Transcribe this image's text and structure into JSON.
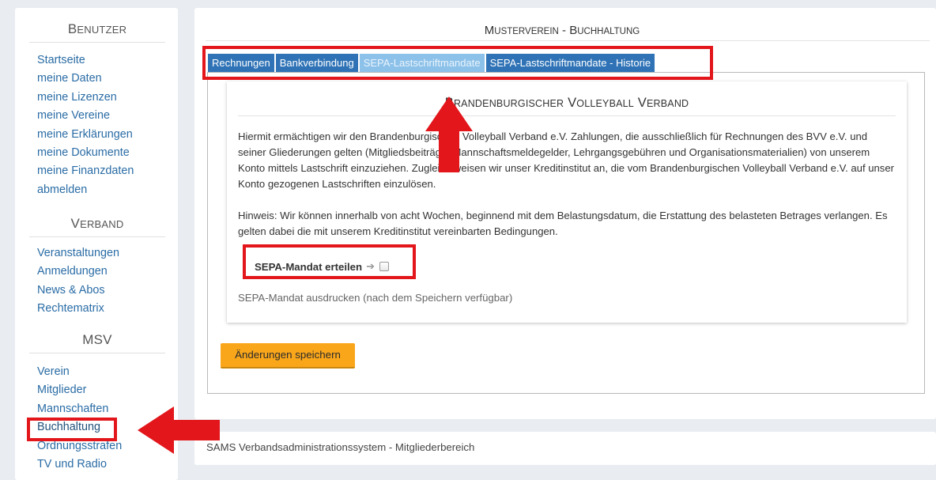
{
  "sidebar": {
    "sections": [
      {
        "title_cap": "B",
        "title_rest": "ENUTZER",
        "items": [
          "Startseite",
          "meine Daten",
          "meine Lizenzen",
          "meine Vereine",
          "meine Erklärungen",
          "meine Dokumente",
          "meine Finanzdaten",
          "abmelden"
        ]
      },
      {
        "title_cap": "V",
        "title_rest": "ERBAND",
        "items": [
          "Veranstaltungen",
          "Anmeldungen",
          "News & Abos",
          "Rechtematrix"
        ]
      },
      {
        "title_cap": "MSV",
        "title_rest": "",
        "items": [
          "Verein",
          "Mitglieder",
          "Mannschaften",
          "Buchhaltung",
          "Ordnungsstrafen",
          "TV und Radio"
        ]
      }
    ]
  },
  "main": {
    "title": {
      "cap1": "M",
      "rest1": "USTERVEREIN",
      "sep": " - ",
      "cap2": "B",
      "rest2": "UCHHALTUNG"
    },
    "tabs": [
      "Rechnungen",
      "Bankverbindung",
      "SEPA-Lastschriftmandate",
      "SEPA-Lastschriftmandate - Historie"
    ],
    "active_tab": "SEPA-Lastschriftmandate",
    "card": {
      "title": {
        "cap1": "B",
        "rest1": "RANDENBURGISCHER",
        "cap2": "V",
        "rest2": "OLLEYBALL",
        "cap3": "V",
        "rest3": "ERBAND"
      },
      "paragraph1": "Hiermit ermächtigen wir den Brandenburgischen Volleyball Verband e.V. Zahlungen, die ausschließlich für Rechnungen des BVV e.V. und seiner Gliederungen gelten (Mitgliedsbeiträge, Mannschaftsmeldegelder, Lehrgangsgebühren und Organisationsmaterialien) von unserem Konto mittels Lastschrift einzuziehen. Zugleich weisen wir unser Kreditinstitut an, die vom Brandenburgischen Volleyball Verband e.V. auf unser Konto gezogenen Lastschriften einzulösen.",
      "paragraph2": "Hinweis: Wir können innerhalb von acht Wochen, beginnend mit dem Belastungsdatum, die Erstattung des belasteten Betrages verlangen. Es gelten dabei die mit unserem Kreditinstitut vereinbarten Bedingungen.",
      "sepa_label": "SEPA-Mandat erteilen",
      "sepa_arrow": "➔",
      "sepa_checked": false,
      "print_note": "SEPA-Mandat ausdrucken (nach dem Speichern verfügbar)"
    },
    "save_button": "Änderungen speichern"
  },
  "footer": {
    "text": "SAMS Verbandsadministrationssystem - Mitgliederbereich"
  },
  "colors": {
    "tab": "#2f73b6",
    "tab_active": "#8cc1e9",
    "link": "#2a6ca5",
    "save_button": "#f9a61a",
    "highlight": "#e2161b",
    "background": "#e9ecf0"
  }
}
